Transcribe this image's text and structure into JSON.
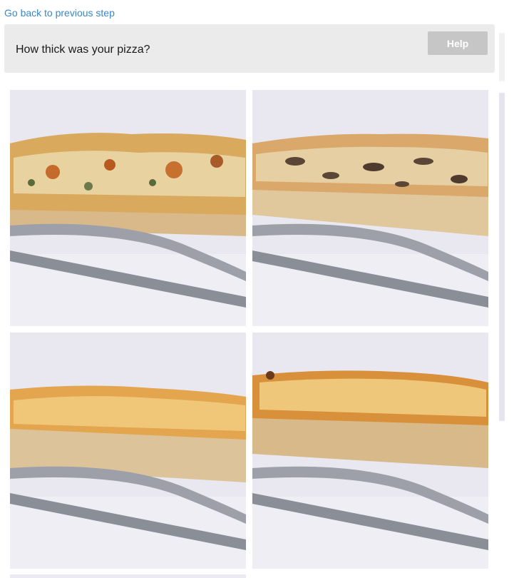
{
  "nav": {
    "back_label": "Go back to previous step"
  },
  "question": {
    "text": "How thick was your pizza?",
    "help_label": "Help"
  },
  "options": [
    {
      "photo": "thin-crust-pizza-slice-with-fork-and-knife"
    },
    {
      "photo": "medium-thin-crust-pizza-slice-with-fork-and-knife"
    },
    {
      "photo": "medium-thick-crust-pizza-slice-with-fork-and-knife"
    },
    {
      "photo": "thick-crust-pizza-slice-with-fork-and-knife"
    }
  ],
  "colors": {
    "link": "#3a87c8",
    "panel_bg": "#ebebeb",
    "help_bg": "#c6c6c6",
    "photo_bg": "#e8e6ef"
  }
}
